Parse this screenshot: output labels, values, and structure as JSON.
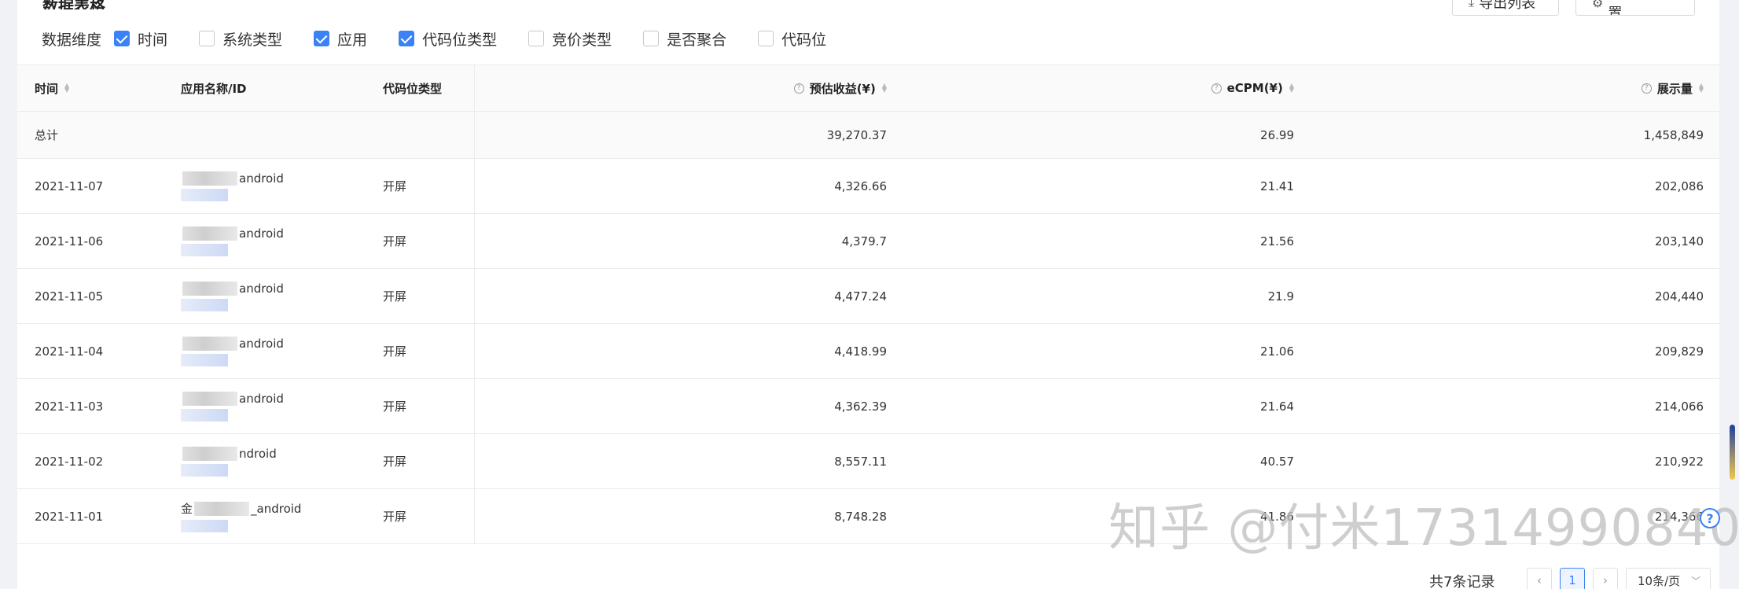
{
  "section_title": "数据表格",
  "buttons": {
    "export": "导出列表",
    "custom": "自定义设置"
  },
  "dimensions": {
    "label": "数据维度",
    "items": [
      {
        "label": "时间",
        "checked": true
      },
      {
        "label": "系统类型",
        "checked": false
      },
      {
        "label": "应用",
        "checked": true
      },
      {
        "label": "代码位类型",
        "checked": true
      },
      {
        "label": "竞价类型",
        "checked": false
      },
      {
        "label": "是否聚合",
        "checked": false
      },
      {
        "label": "代码位",
        "checked": false
      }
    ]
  },
  "table": {
    "headers": {
      "date": "时间",
      "app": "应用名称/ID",
      "type": "代码位类型",
      "revenue": "预估收益(¥)",
      "ecpm": "eCPM(¥)",
      "impressions": "展示量"
    },
    "total": {
      "label": "总计",
      "revenue": "39,270.37",
      "ecpm": "26.99",
      "impressions": "1,458,849"
    },
    "rows": [
      {
        "date": "2021-11-07",
        "app_prefix": "",
        "app": "android",
        "type": "开屏",
        "revenue": "4,326.66",
        "ecpm": "21.41",
        "impressions": "202,086"
      },
      {
        "date": "2021-11-06",
        "app_prefix": "",
        "app": "android",
        "type": "开屏",
        "revenue": "4,379.7",
        "ecpm": "21.56",
        "impressions": "203,140"
      },
      {
        "date": "2021-11-05",
        "app_prefix": "",
        "app": "android",
        "type": "开屏",
        "revenue": "4,477.24",
        "ecpm": "21.9",
        "impressions": "204,440"
      },
      {
        "date": "2021-11-04",
        "app_prefix": "",
        "app": "android",
        "type": "开屏",
        "revenue": "4,418.99",
        "ecpm": "21.06",
        "impressions": "209,829"
      },
      {
        "date": "2021-11-03",
        "app_prefix": "",
        "app": "android",
        "type": "开屏",
        "revenue": "4,362.39",
        "ecpm": "21.64",
        "impressions": "214,066"
      },
      {
        "date": "2021-11-02",
        "app_prefix": "",
        "app": "ndroid",
        "type": "开屏",
        "revenue": "8,557.11",
        "ecpm": "40.57",
        "impressions": "210,922"
      },
      {
        "date": "2021-11-01",
        "app_prefix": "金",
        "app": "_android",
        "type": "开屏",
        "revenue": "8,748.28",
        "ecpm": "41.86",
        "impressions": "214,366"
      }
    ]
  },
  "pagination": {
    "total_text": "共7条记录",
    "prev": "‹",
    "current": "1",
    "next": "›",
    "page_size": "10条/页"
  },
  "watermark": "知乎 @付米17314990840",
  "help_symbol": "?",
  "icons": {
    "export": "download-icon",
    "custom": "gear-icon",
    "help": "question-circle-icon",
    "sort": "sort-icon"
  },
  "colors": {
    "accent": "#3b82f6"
  }
}
